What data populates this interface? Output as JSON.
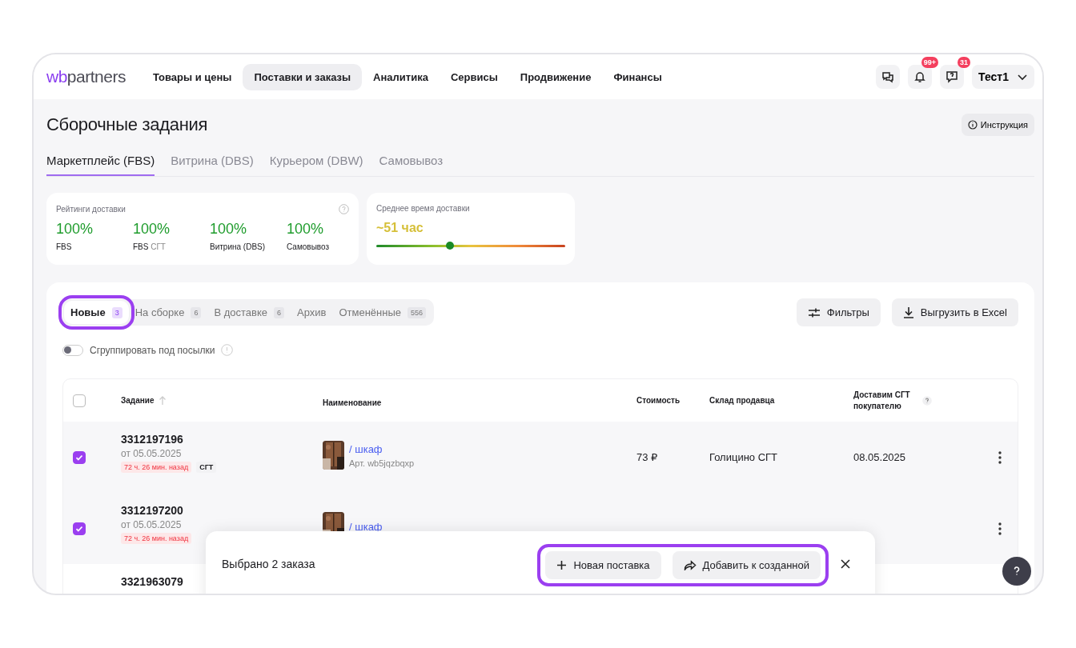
{
  "logo": {
    "accent": "wb",
    "rest": "partners"
  },
  "nav": [
    {
      "label": "Товары и цены",
      "selected": false
    },
    {
      "label": "Поставки и заказы",
      "selected": true
    },
    {
      "label": "Аналитика",
      "selected": false
    },
    {
      "label": "Сервисы",
      "selected": false
    },
    {
      "label": "Продвижение",
      "selected": false
    },
    {
      "label": "Финансы",
      "selected": false
    }
  ],
  "header_icons": [
    {
      "kind": "chat"
    },
    {
      "kind": "bell",
      "badge": "99+"
    },
    {
      "kind": "help",
      "badge": "31"
    }
  ],
  "user": {
    "name": "Тест1"
  },
  "page_title": "Сборочные задания",
  "instruction_button": "Инструкция",
  "channel_tabs": [
    {
      "label": "Маркетплейс (FBS)",
      "selected": true
    },
    {
      "label": "Витрина (DBS)",
      "selected": false
    },
    {
      "label": "Курьером (DBW)",
      "selected": false
    },
    {
      "label": "Самовывоз",
      "selected": false
    }
  ],
  "ratings": {
    "title": "Рейтинги доставки",
    "items": [
      {
        "value": "100%",
        "label": "FBS"
      },
      {
        "value": "100%",
        "label": "FBS",
        "label_extra": "СГТ"
      },
      {
        "value": "100%",
        "label": "Витрина (DBS)"
      },
      {
        "value": "100%",
        "label": "Самовывоз"
      }
    ]
  },
  "delivery_time": {
    "title": "Среднее время доставки",
    "value": "~51 час",
    "level": 0.39
  },
  "status_tabs": [
    {
      "label": "Новые",
      "count": "3",
      "selected": true,
      "highlighted": true
    },
    {
      "label": "На сборке",
      "count": "6",
      "selected": false,
      "highlighted": false
    },
    {
      "label": "В доставке",
      "count": "6",
      "selected": false,
      "highlighted": false
    },
    {
      "label": "Архив",
      "selected": false,
      "highlighted": false
    },
    {
      "label": "Отменённые",
      "count": "556",
      "selected": false,
      "highlighted": false
    }
  ],
  "filters_button": "Фильтры",
  "export_button": "Выгрузить в Excel",
  "group_toggle": {
    "label": "Сгруппировать под посылки",
    "on": false
  },
  "table": {
    "all_checked": false,
    "columns": [
      "Задание",
      "Наименование",
      "Стоимость",
      "Склад продавца",
      "Доставим СГТ покупателю"
    ],
    "rows": [
      {
        "checked": true,
        "order": "3312197196",
        "date": "от 05.05.2025",
        "age": "72 ч. 26 мин. назад",
        "tag": "СГТ",
        "product": "/ шкаф",
        "article": "Арт. wb5jqzbqxp",
        "price": "73 ₽",
        "warehouse": "Голицино СГТ",
        "delivery": "08.05.2025"
      },
      {
        "checked": true,
        "order": "3312197200",
        "date": "от 05.05.2025",
        "age": "72 ч. 26 мин. назад",
        "product": "/ шкаф"
      },
      {
        "order": "3321963079"
      }
    ]
  },
  "selection_bar": {
    "text": "Выбрано 2 заказа",
    "highlighted": true,
    "actions": [
      {
        "kind": "plus",
        "label": "Новая поставка"
      },
      {
        "kind": "share",
        "label": "Добавить к созданной"
      }
    ]
  }
}
